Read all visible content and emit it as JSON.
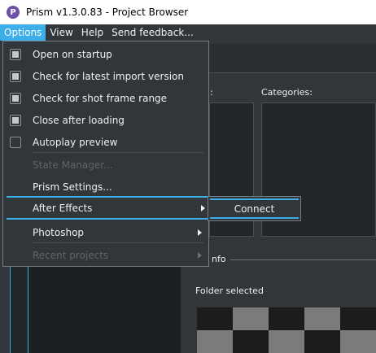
{
  "window": {
    "logo_letter": "P",
    "title": "Prism v1.3.0.83 - Project Browser"
  },
  "menubar": {
    "items": [
      {
        "label": "Options",
        "active": true
      },
      {
        "label": "View"
      },
      {
        "label": "Help"
      },
      {
        "label": "Send feedback..."
      }
    ]
  },
  "background": {
    "left_label_fragment": ":",
    "categories_label": "Categories:",
    "info_label_fragment": "nfo",
    "folder_selected": "Folder selected"
  },
  "options_menu": {
    "items": [
      {
        "label": "Open on startup",
        "checkbox": true,
        "checked": true
      },
      {
        "label": "Check for latest import version",
        "checkbox": true,
        "checked": true
      },
      {
        "label": "Check for shot frame range",
        "checkbox": true,
        "checked": true
      },
      {
        "label": "Close after loading",
        "checkbox": true,
        "checked": true
      },
      {
        "label": "Autoplay preview",
        "checkbox": true,
        "checked": false
      },
      {
        "label": "State Manager...",
        "disabled": true
      },
      {
        "label": "Prism Settings..."
      },
      {
        "label": "After Effects",
        "submenu": true,
        "highlighted": true
      },
      {
        "label": "Photoshop",
        "submenu": true
      },
      {
        "label": "Recent projects",
        "submenu": true,
        "disabled": true
      }
    ]
  },
  "after_effects_submenu": {
    "items": [
      {
        "label": "Connect",
        "highlighted": true
      }
    ]
  },
  "colors": {
    "accent": "#3daee9",
    "background": "#31363b",
    "text": "#eff0f1"
  }
}
